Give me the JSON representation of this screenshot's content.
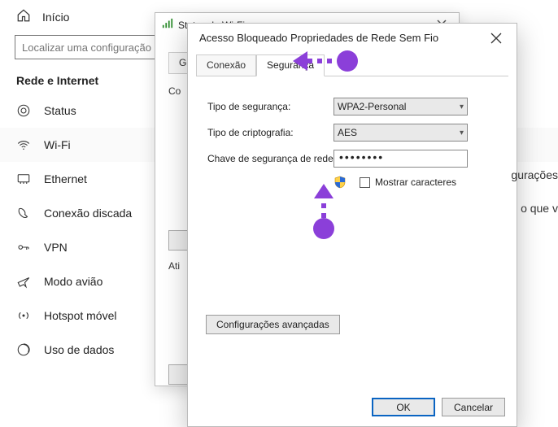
{
  "settings": {
    "home": "Início",
    "search_placeholder": "Localizar uma configuração",
    "category": "Rede e Internet",
    "items": [
      {
        "label": "Status"
      },
      {
        "label": "Wi-Fi"
      },
      {
        "label": "Ethernet"
      },
      {
        "label": "Conexão discada"
      },
      {
        "label": "VPN"
      },
      {
        "label": "Modo avião"
      },
      {
        "label": "Hotspot móvel"
      },
      {
        "label": "Uso de dados"
      }
    ]
  },
  "status_window": {
    "title": "Status de Wi-Fi",
    "tab_fragment": "Gera",
    "label_fragment": "Co",
    "btn_fragment": "Ati"
  },
  "dialog": {
    "title": "Acesso Bloqueado Propriedades de Rede Sem Fio",
    "tabs": {
      "connection": "Conexão",
      "security": "Segurança"
    },
    "labels": {
      "sec_type": "Tipo de segurança:",
      "enc_type": "Tipo de criptografia:",
      "net_key": "Chave de segurança de rede",
      "show_chars": "Mostrar caracteres",
      "advanced": "Configurações avançadas"
    },
    "values": {
      "sec_type": "WPA2-Personal",
      "enc_type": "AES",
      "pw": "••••••••"
    },
    "buttons": {
      "ok": "OK",
      "cancel": "Cancelar"
    }
  },
  "edge": {
    "t1": "gurações",
    "t2": "o que v"
  }
}
